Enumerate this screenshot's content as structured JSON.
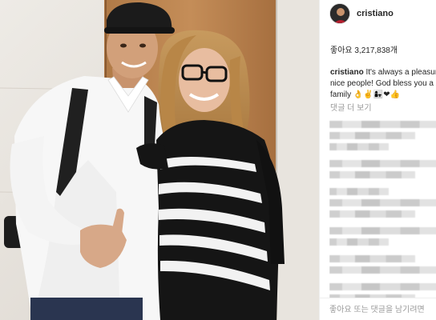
{
  "post": {
    "username": "cristiano",
    "likes_label": "좋아요 3,217,838개",
    "caption_user": "cristiano",
    "caption_lines": [
      " It's always a pleasure",
      "nice people! God bless you a",
      "family"
    ],
    "caption_emoji": "👌✌👩‍👧❤👍",
    "view_more": "댓글 더 보기",
    "comment_placeholder": "좋아요 또는 댓글을 남기려면"
  },
  "icons": {
    "avatar": "profile-avatar-icon"
  }
}
